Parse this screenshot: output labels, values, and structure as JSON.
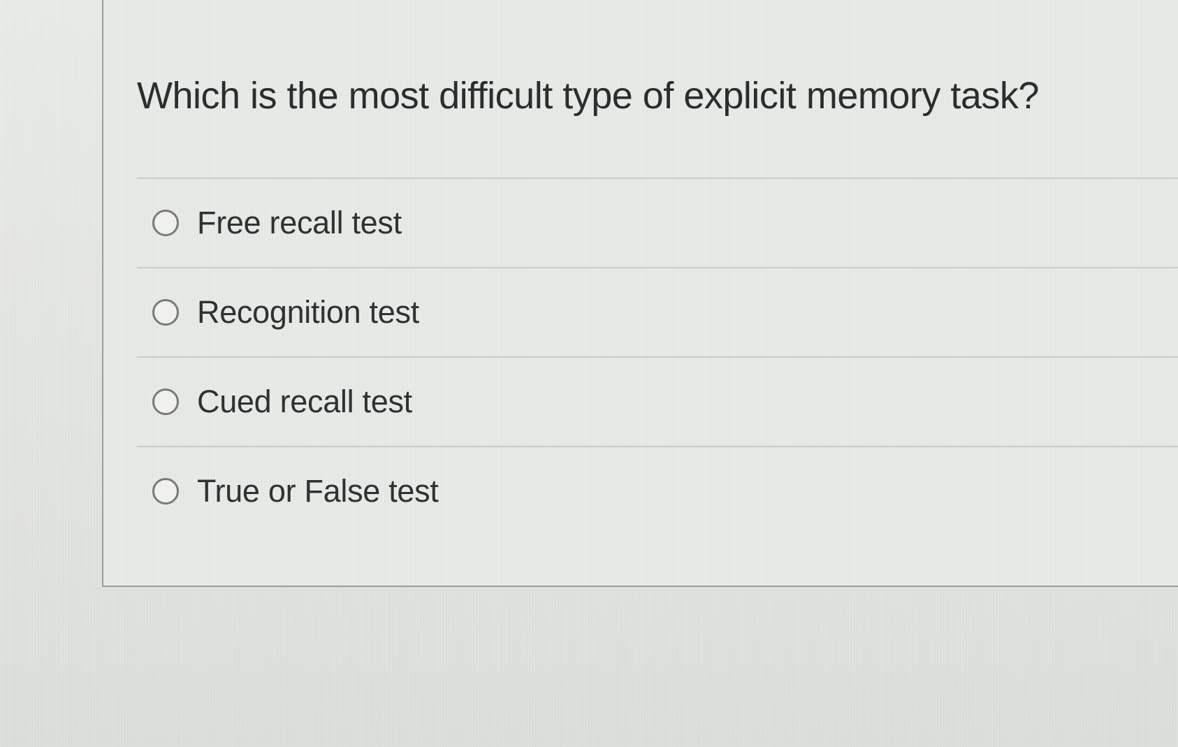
{
  "question": {
    "text": "Which is the most difficult type of explicit memory task?"
  },
  "answers": [
    {
      "label": "Free recall test",
      "selected": false
    },
    {
      "label": "Recognition test",
      "selected": false
    },
    {
      "label": "Cued recall test",
      "selected": false
    },
    {
      "label": "True or False test",
      "selected": false
    }
  ],
  "colors": {
    "background": "#e4e6e3",
    "text": "#2b2d2e",
    "radio_border": "#777a78",
    "divider": "#c9cbc8",
    "card_border": "#9a9c99"
  }
}
